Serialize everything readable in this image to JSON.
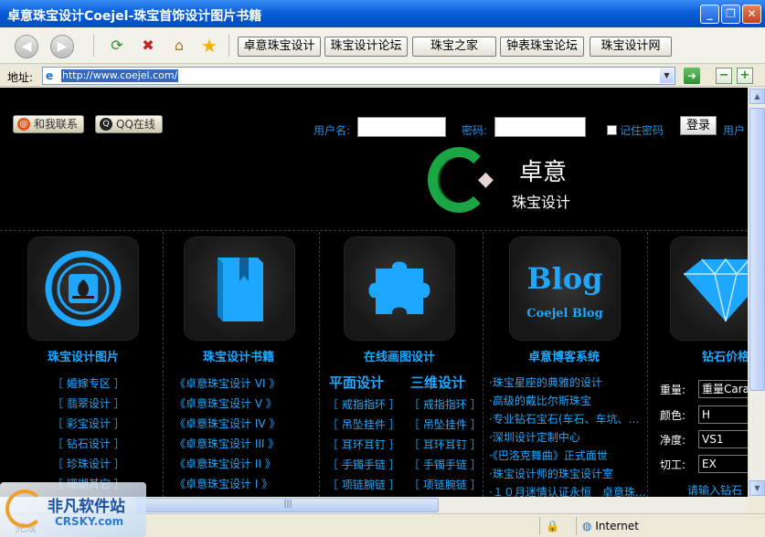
{
  "window": {
    "title": "卓意珠宝设计Coejel-珠宝首饰设计图片书籍",
    "controls": [
      "minimize-icon",
      "restore-icon",
      "close-icon"
    ]
  },
  "toolbar": {
    "links": [
      "卓意珠宝设计",
      "珠宝设计论坛",
      "珠宝之家",
      "钟表珠宝论坛",
      "珠宝设计网"
    ]
  },
  "address": {
    "label": "地址:",
    "url": "http://www.coejel.com/"
  },
  "header": {
    "contact": "和我联系",
    "qq": "QQ在线",
    "username_label": "用户名:",
    "password_label": "密码:",
    "remember": "记住密码",
    "login": "登录",
    "user_link": "用户"
  },
  "logo": {
    "title": "卓意",
    "subtitle": "珠宝设计"
  },
  "columns": [
    {
      "title": "珠宝设计图片",
      "icon": "flower-emblem-icon",
      "links": [
        "［ 婚嫁专区 ］",
        "［ 翡翠设计 ］",
        "［ 彩宝设计 ］",
        "［ 钻石设计 ］",
        "［ 珍珠设计 ］",
        "［ 珊瑚其它 ］"
      ]
    },
    {
      "title": "珠宝设计书籍",
      "icon": "book-icon",
      "links": [
        "《卓意珠宝设计 VI 》",
        "《卓意珠宝设计 V 》",
        "《卓意珠宝设计 IV 》",
        "《卓意珠宝设计 III 》",
        "《卓意珠宝设计 II 》",
        "《卓意珠宝设计 I 》"
      ]
    },
    {
      "title": "在线画图设计",
      "icon": "puzzle-icon",
      "sub_left": "平面设计",
      "sub_right": "三维设计",
      "links_left": [
        "［ 戒指指环 ］",
        "［ 吊坠挂件 ］",
        "［ 耳环耳钉 ］",
        "［ 手镯手链 ］",
        "［ 项链腕链 ］"
      ],
      "links_right": [
        "［ 戒指指环 ］",
        "［ 吊坠挂件 ］",
        "［ 耳环耳钉 ］",
        "［ 手镯手链 ］",
        "［ 项链腕链 ］"
      ]
    },
    {
      "title": "卓意博客系统",
      "icon": "blog-icon",
      "icon_text": "Blog",
      "icon_sub": "Coejel Blog",
      "links": [
        "·珠宝星座的典雅的设计",
        "·高级的戴比尔斯珠宝",
        "·专业钻石宝石(车石、车坑、…",
        "·深圳设计定制中心",
        "·《巴洛克舞曲》正式面世",
        "·珠宝设计师的珠宝设计室",
        "·１０月迷情认证永恒　卓意珠…"
      ]
    },
    {
      "title": "钻石价格",
      "icon": "diamond-icon",
      "fields": [
        {
          "label": "重量:",
          "value": "重量Carat"
        },
        {
          "label": "颜色:",
          "value": "H"
        },
        {
          "label": "净度:",
          "value": "VS1"
        },
        {
          "label": "切工:",
          "value": "EX"
        }
      ],
      "hint": "请输入钻石"
    }
  ],
  "status": {
    "text": "完成",
    "zone": "Internet"
  },
  "watermark": {
    "name": "非凡软件站",
    "url": "CRSKY.com"
  },
  "colors": {
    "accent": "#1ea7ff",
    "titlebar": "#0a5fd8",
    "page_bg": "#000000",
    "logo_green": "#1aa644"
  }
}
